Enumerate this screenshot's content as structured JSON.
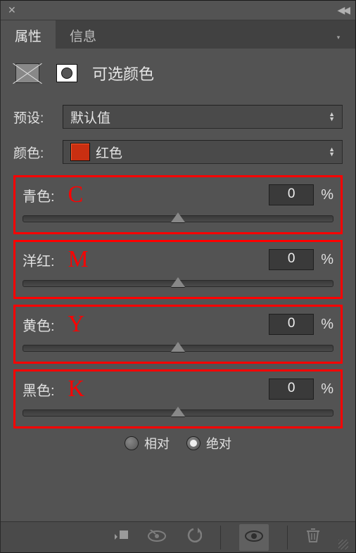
{
  "topbar": {
    "close": "✕",
    "collapse": "◀◀"
  },
  "tabs": {
    "properties": "属性",
    "info": "信息"
  },
  "header": {
    "title": "可选颜色"
  },
  "preset": {
    "label": "预设:",
    "value": "默认值"
  },
  "color": {
    "label": "颜色:",
    "value": "红色",
    "swatch": "#c92f11"
  },
  "sliders": {
    "cyan": {
      "label": "青色:",
      "letter": "C",
      "value": "0",
      "unit": "%"
    },
    "magenta": {
      "label": "洋红:",
      "letter": "M",
      "value": "0",
      "unit": "%"
    },
    "yellow": {
      "label": "黄色:",
      "letter": "Y",
      "value": "0",
      "unit": "%"
    },
    "black": {
      "label": "黑色:",
      "letter": "K",
      "value": "0",
      "unit": "%"
    }
  },
  "method": {
    "relative": "相对",
    "absolute": "绝对",
    "selected": "absolute"
  }
}
